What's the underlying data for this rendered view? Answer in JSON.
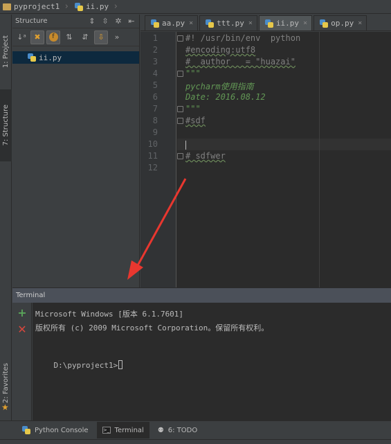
{
  "navbar": {
    "project": "pyproject1",
    "file": "ii.py"
  },
  "left_stripe": {
    "project_tab": "1: Project",
    "structure_tab": "7: Structure",
    "favorites_tab": "2: Favorites"
  },
  "structure": {
    "title": "Structure",
    "tree_item": "ii.py"
  },
  "editor": {
    "tabs": [
      {
        "label": "aa.py",
        "close": "×"
      },
      {
        "label": "ttt.py",
        "close": "×"
      },
      {
        "label": "ii.py",
        "close": "×"
      },
      {
        "label": "op.py",
        "close": "×"
      }
    ],
    "line_numbers": [
      "1",
      "2",
      "3",
      "4",
      "5",
      "6",
      "7",
      "8",
      "9",
      "10",
      "11",
      "12"
    ],
    "lines": [
      "#! /usr/bin/env  python",
      "#encoding:utf8",
      "#  author   = \"huazai\"",
      "\"\"\"",
      "pycharm使用指南",
      "Date: 2016.08.12",
      "\"\"\"",
      "#sdf",
      "",
      "",
      "# sdfwer",
      ""
    ]
  },
  "terminal": {
    "title": "Terminal",
    "line1": "Microsoft Windows [版本 6.1.7601]",
    "line2": "版权所有 (c) 2009 Microsoft Corporation。保留所有权利。",
    "prompt": "D:\\pyproject1>"
  },
  "bottom_tabs": {
    "python_console": "Python Console",
    "terminal": "Terminal",
    "todo": "6: TODO"
  },
  "colors": {
    "arrow": "#e8372f",
    "docstring": "#629755",
    "comment": "#808080"
  }
}
